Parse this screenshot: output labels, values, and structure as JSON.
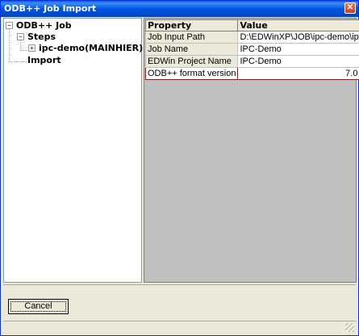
{
  "window": {
    "title": "ODB++ Job Import",
    "close_glyph": "✕"
  },
  "tree": {
    "root": {
      "label": "ODB++ Job",
      "toggle": "−"
    },
    "steps": {
      "label": "Steps",
      "toggle": "−"
    },
    "step_item": {
      "label": "ipc-demo(MAINHIER)",
      "toggle": "+"
    },
    "import": {
      "label": "Import"
    }
  },
  "grid": {
    "headers": [
      "Property",
      "Value"
    ],
    "rows": [
      {
        "property": "Job Input Path",
        "value": "D:\\EDWinXP\\JOB\\ipc-demo\\ipc"
      },
      {
        "property": "Job Name",
        "value": "IPC-Demo"
      },
      {
        "property": "EDWin Project Name",
        "value": "IPC-Demo"
      },
      {
        "property": "ODB++ format version",
        "value": "7.0"
      }
    ]
  },
  "buttons": {
    "cancel": "Cancel"
  }
}
